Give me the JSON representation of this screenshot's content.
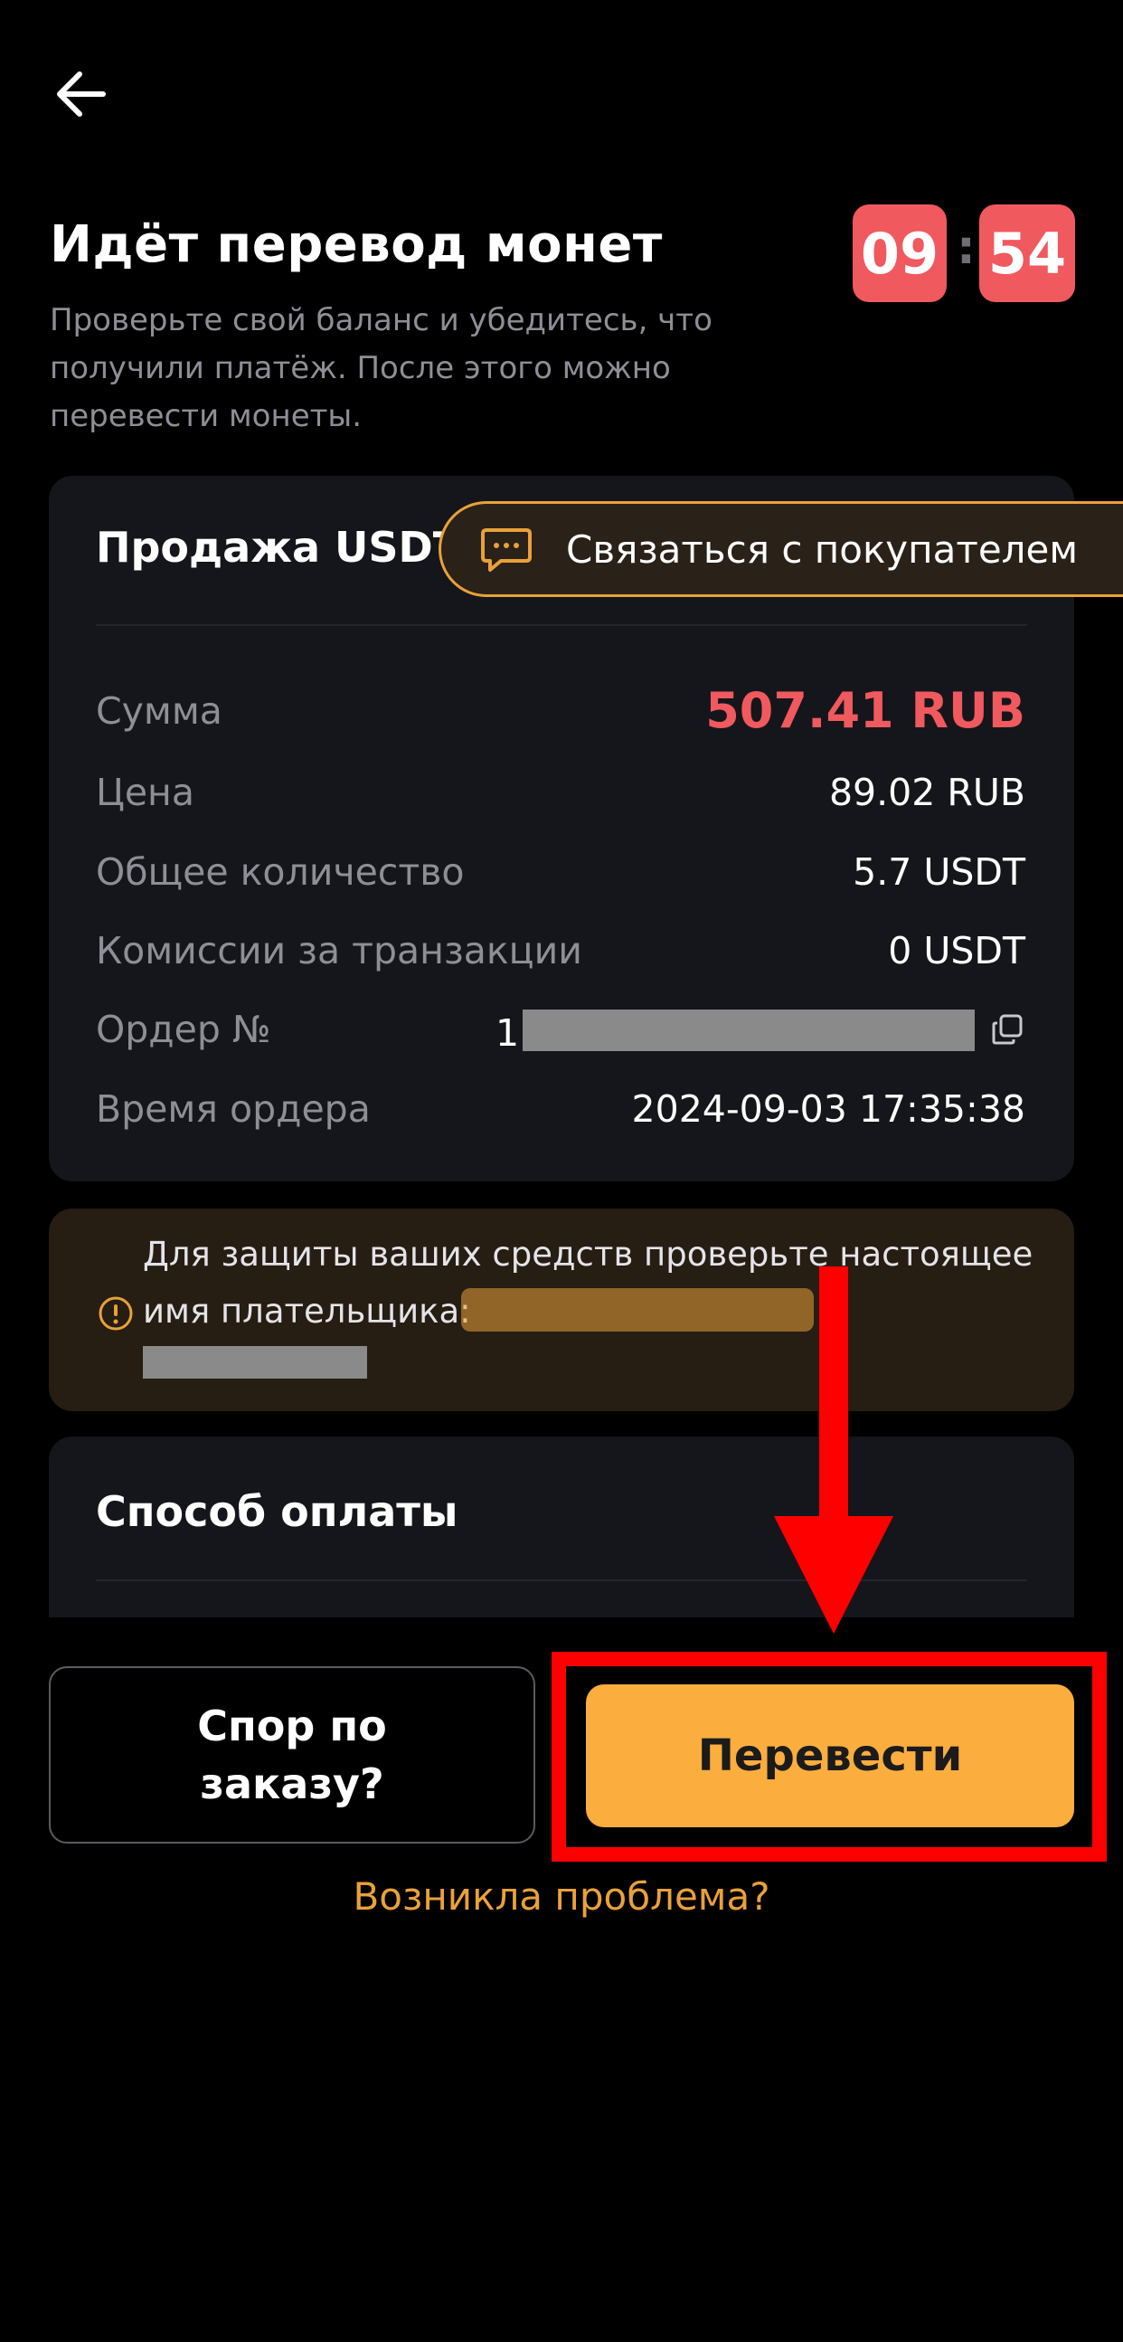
{
  "header": {
    "back_icon": "arrow-left-icon",
    "title": "Идёт перевод монет",
    "subtitle": "Проверьте свой баланс и убедитесь, что получили платёж. После этого можно перевести монеты.",
    "timer": {
      "minutes": "09",
      "separator": ":",
      "seconds": "54"
    }
  },
  "order_card": {
    "title": "Продажа USDT",
    "contact_button": {
      "icon": "chat-icon",
      "label": "Связаться с покупателем"
    },
    "rows": {
      "amount": {
        "label": "Сумма",
        "value": "507.41 RUB"
      },
      "price": {
        "label": "Цена",
        "value": "89.02 RUB"
      },
      "quantity": {
        "label": "Общее количество",
        "value": "5.7 USDT"
      },
      "fee": {
        "label": "Комиссии за транзакции",
        "value": "0 USDT"
      },
      "order_no": {
        "label": "Ордер №",
        "value_prefix": "1",
        "copy_icon": "copy-icon"
      },
      "order_time": {
        "label": "Время ордера",
        "value": "2024-09-03 17:35:38"
      }
    }
  },
  "warning": {
    "icon": "alert-circle-icon",
    "line1": "Для защиты ваших средств проверьте настоящее",
    "line2": "имя плательщика:"
  },
  "payment": {
    "title": "Способ оплаты"
  },
  "actions": {
    "dispute_label": "Спор по заказу?",
    "transfer_label": "Перевести",
    "problem_link": "Возникла проблема?"
  },
  "colors": {
    "background": "#000000",
    "card": "#15161b",
    "accent_yellow": "#fbad3e",
    "accent_red": "#f0595e",
    "annotation_red": "#ff0000"
  }
}
